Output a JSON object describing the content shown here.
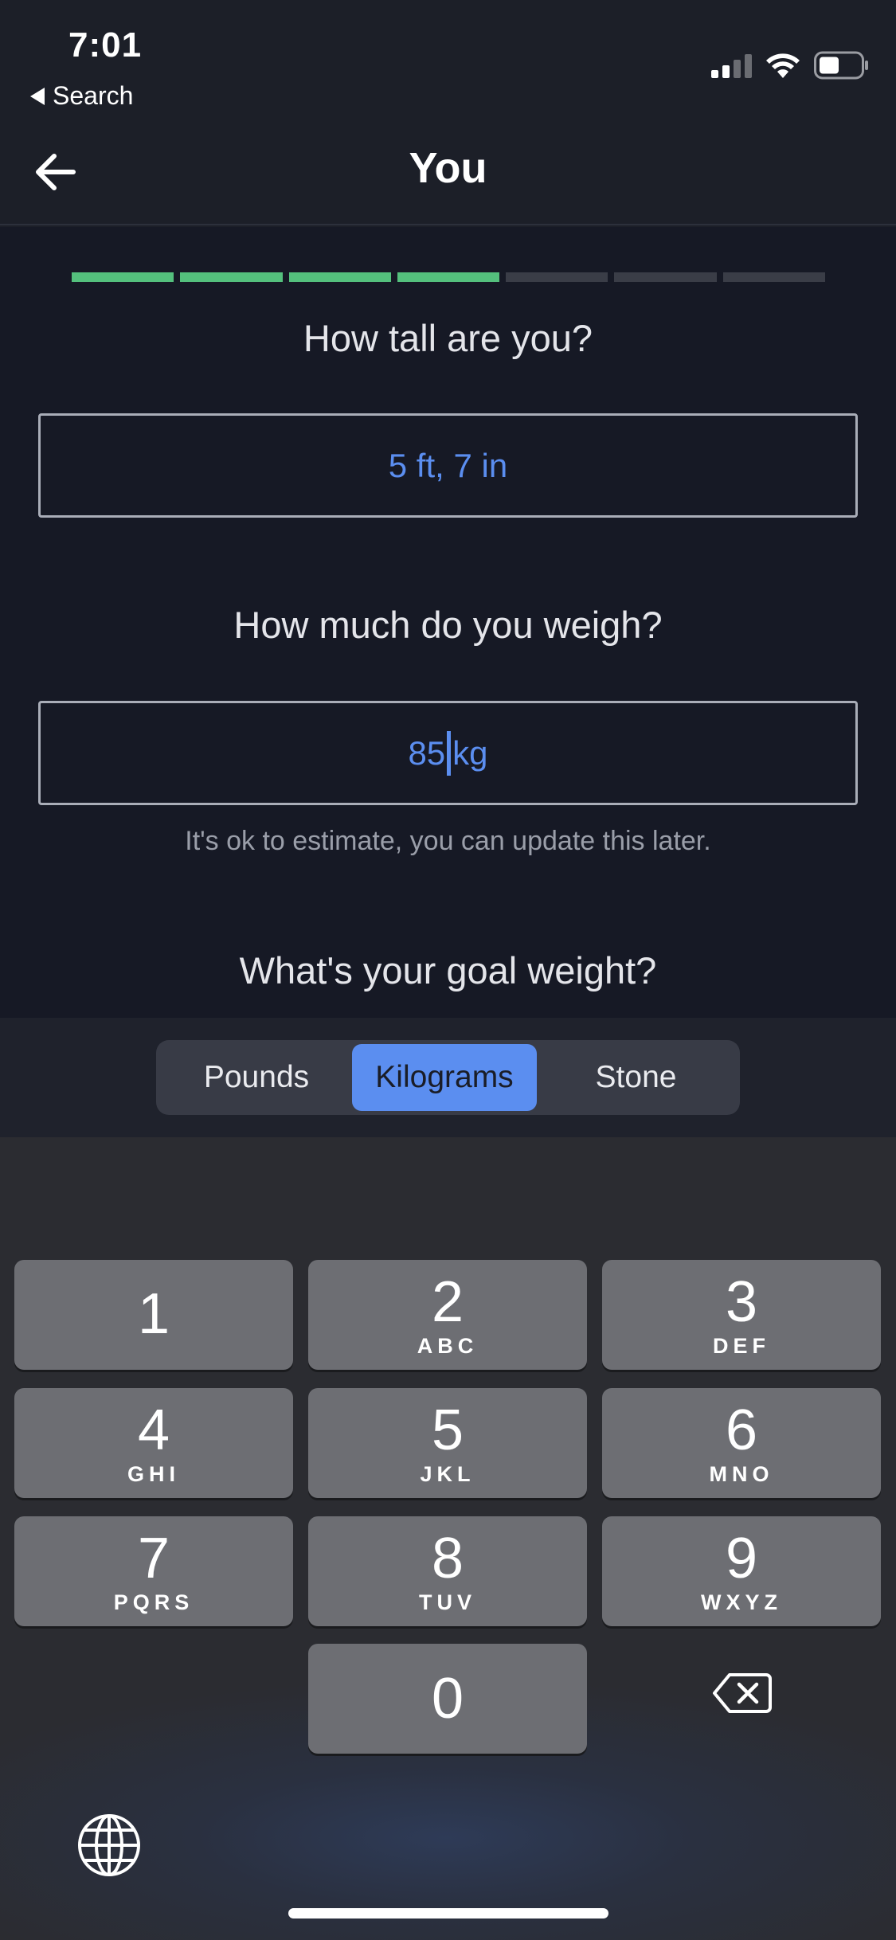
{
  "status_bar": {
    "time": "7:01",
    "back_label": "Search"
  },
  "header": {
    "title": "You",
    "back_icon": "arrow-left-icon"
  },
  "progress": {
    "total_steps": 7,
    "completed_steps": 4,
    "done_color": "#54c07d",
    "pending_color": "#3a3d47"
  },
  "form": {
    "height_question": "How tall are you?",
    "height_value": "5 ft, 7 in",
    "weight_question": "How much do you weigh?",
    "weight_value_before_cursor": "85",
    "weight_value_after_cursor": "kg",
    "weight_hint": "It's ok to estimate, you can update this later.",
    "goal_question": "What's your goal weight?"
  },
  "units": {
    "options": [
      "Pounds",
      "Kilograms",
      "Stone"
    ],
    "selected": "Kilograms",
    "accent_color": "#5b8ef0"
  },
  "keypad": {
    "keys": [
      {
        "num": "1",
        "letters": ""
      },
      {
        "num": "2",
        "letters": "ABC"
      },
      {
        "num": "3",
        "letters": "DEF"
      },
      {
        "num": "4",
        "letters": "GHI"
      },
      {
        "num": "5",
        "letters": "JKL"
      },
      {
        "num": "6",
        "letters": "MNO"
      },
      {
        "num": "7",
        "letters": "PQRS"
      },
      {
        "num": "8",
        "letters": "TUV"
      },
      {
        "num": "9",
        "letters": "WXYZ"
      },
      {
        "num": "0",
        "letters": ""
      }
    ],
    "delete_icon": "backspace-icon",
    "globe_icon": "globe-icon"
  }
}
